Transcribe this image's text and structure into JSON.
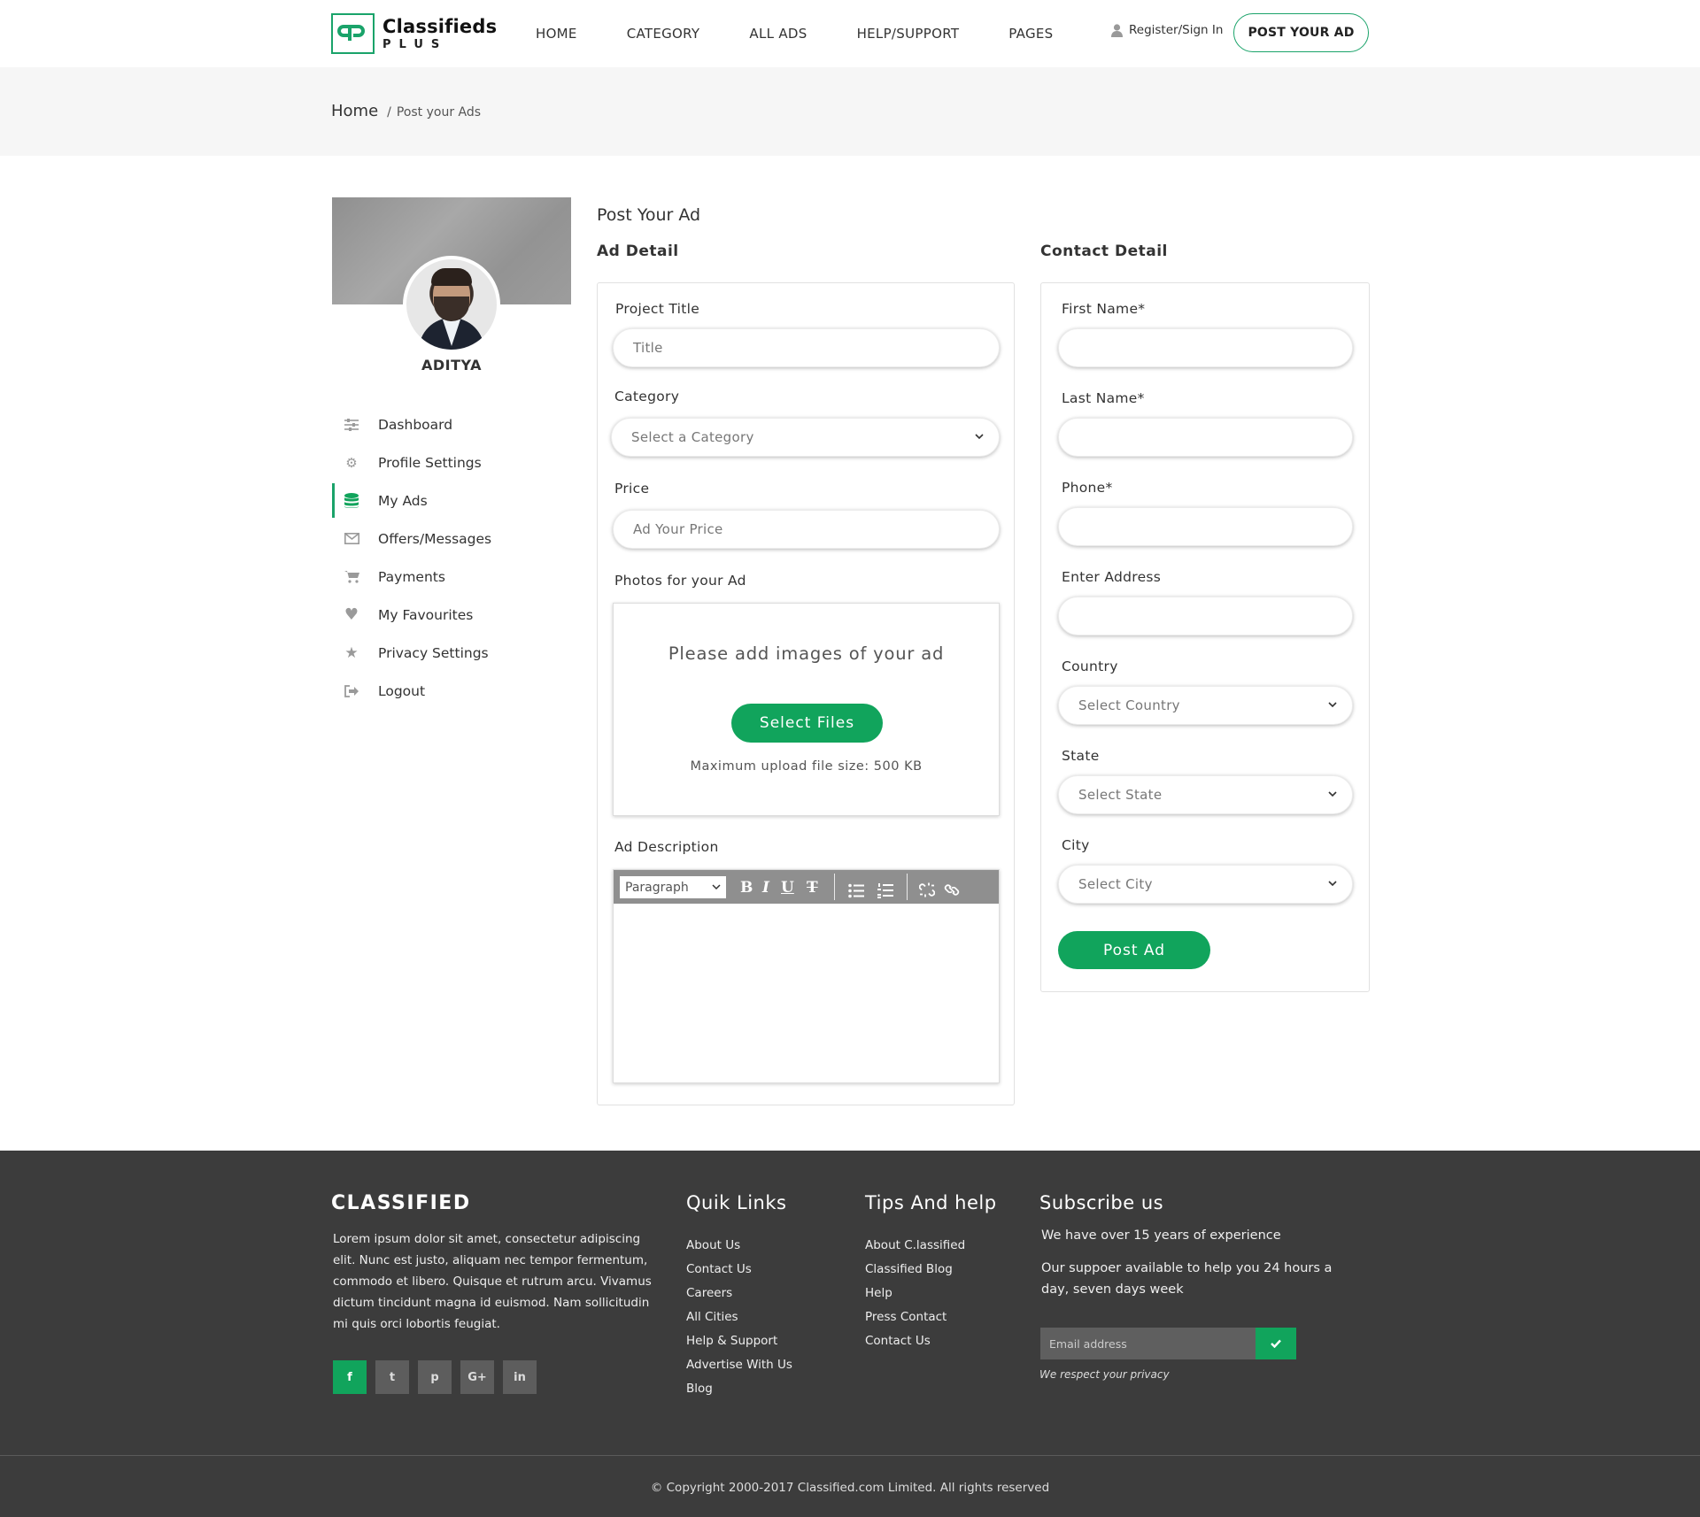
{
  "header": {
    "logo_title": "Classifieds",
    "logo_sub": "PLUS",
    "nav": [
      "HOME",
      "CATEGORY",
      "ALL ADS",
      "HELP/SUPPORT",
      "PAGES"
    ],
    "signin": "Register/Sign In",
    "post_button": "POST YOUR AD"
  },
  "breadcrumb": {
    "home": "Home",
    "sep": "/",
    "current": "Post your Ads"
  },
  "sidebar": {
    "user_name": "ADITYA",
    "items": [
      {
        "label": "Dashboard",
        "icon": "sliders-icon"
      },
      {
        "label": "Profile Settings",
        "icon": "gear-icon"
      },
      {
        "label": "My Ads",
        "icon": "database-icon",
        "active": true
      },
      {
        "label": "Offers/Messages",
        "icon": "envelope-icon"
      },
      {
        "label": "Payments",
        "icon": "cart-icon"
      },
      {
        "label": "My Favourites",
        "icon": "heart-icon"
      },
      {
        "label": "Privacy Settings",
        "icon": "star-icon"
      },
      {
        "label": "Logout",
        "icon": "sign-out-icon"
      }
    ]
  },
  "form": {
    "page_title": "Post Your Ad",
    "ad_heading": "Ad Detail",
    "contact_heading": "Contact Detail",
    "project_title_label": "Project Title",
    "project_title_placeholder": "Title",
    "category_label": "Category",
    "category_value": "Select a Category",
    "price_label": "Price",
    "price_placeholder": "Ad Your Price",
    "photos_label": "Photos for your Ad",
    "upload_text": "Please add images of your ad",
    "select_files": "Select Files",
    "max_size": "Maximum upload file size: 500 KB",
    "description_label": "Ad Description",
    "editor_format": "Paragraph",
    "first_name_label": "First Name*",
    "last_name_label": "Last Name*",
    "phone_label": "Phone*",
    "address_label": "Enter Address",
    "country_label": "Country",
    "country_value": "Select Country",
    "state_label": "State",
    "state_value": "Select State",
    "city_label": "City",
    "city_value": "Select City",
    "post_ad": "Post Ad"
  },
  "footer": {
    "brand": "CLASSIFIED",
    "description": "Lorem ipsum dolor sit amet, consectetur adipiscing elit. Nunc est justo, aliquam nec tempor fermentum, commodo et libero. Quisque et rutrum arcu. Vivamus dictum tincidunt magna id euismod. Nam sollicitudin mi quis orci lobortis feugiat.",
    "socials": [
      "f",
      "t",
      "p",
      "G+",
      "in"
    ],
    "quick_title": "Quik Links",
    "quick_links": [
      "About Us",
      "Contact Us",
      "Careers",
      "All Cities",
      "Help & Support",
      "Advertise With Us",
      "Blog"
    ],
    "tips_title": "Tips And help",
    "tips_links": [
      "About C.lassified",
      "Classified Blog",
      "Help",
      "Press Contact",
      "Contact Us"
    ],
    "subscribe_title": "Subscribe us",
    "subscribe_line1": "We have over 15 years of experience",
    "subscribe_line2": "Our suppoer available to help you 24 hours a day, seven days week",
    "email_placeholder": "Email address",
    "privacy": "We respect your privacy",
    "copyright": "© Copyright 2000-2017 Classified.com Limited. All rights reserved"
  },
  "colors": {
    "accent": "#11a45c",
    "footer_bg": "#3c3c3c"
  }
}
